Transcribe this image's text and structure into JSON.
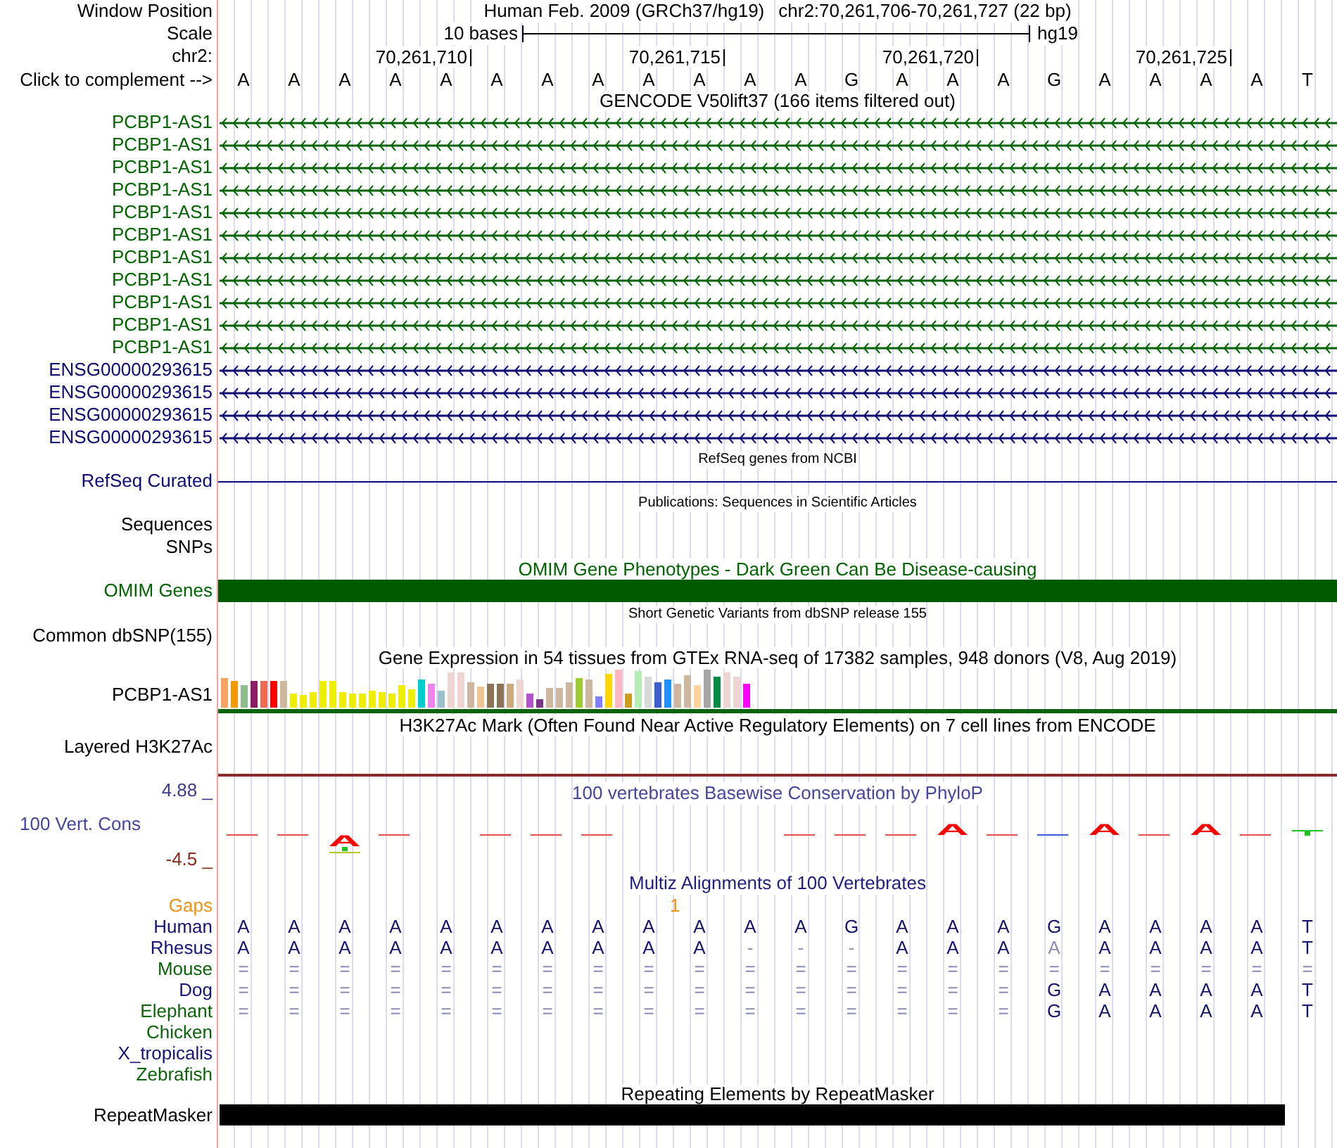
{
  "position": {
    "label": "Window Position",
    "assembly": "Human Feb. 2009 (GRCh37/hg19)",
    "region": "chr2:70,261,706-70,261,727 (22 bp)"
  },
  "scale": {
    "label": "Scale",
    "length": "10 bases",
    "assembly": "hg19"
  },
  "coordinates": {
    "label": "chr2:",
    "ticks": [
      "70,261,710",
      "70,261,715",
      "70,261,720",
      "70,261,725"
    ]
  },
  "sequence": {
    "label": "Click to complement -->",
    "bases": [
      "A",
      "A",
      "A",
      "A",
      "A",
      "A",
      "A",
      "A",
      "A",
      "A",
      "A",
      "A",
      "G",
      "A",
      "A",
      "A",
      "G",
      "A",
      "A",
      "A",
      "A",
      "T"
    ]
  },
  "gencode": {
    "title": "GENCODE V50lift37 (166 items filtered out)",
    "items": [
      {
        "name": "PCBP1-AS1",
        "color": "#006400"
      },
      {
        "name": "PCBP1-AS1",
        "color": "#006400"
      },
      {
        "name": "PCBP1-AS1",
        "color": "#006400"
      },
      {
        "name": "PCBP1-AS1",
        "color": "#006400"
      },
      {
        "name": "PCBP1-AS1",
        "color": "#006400"
      },
      {
        "name": "PCBP1-AS1",
        "color": "#006400"
      },
      {
        "name": "PCBP1-AS1",
        "color": "#006400"
      },
      {
        "name": "PCBP1-AS1",
        "color": "#006400"
      },
      {
        "name": "PCBP1-AS1",
        "color": "#006400"
      },
      {
        "name": "PCBP1-AS1",
        "color": "#006400"
      },
      {
        "name": "PCBP1-AS1",
        "color": "#006400"
      },
      {
        "name": "ENSG00000293615",
        "color": "#0c0c78"
      },
      {
        "name": "ENSG00000293615",
        "color": "#0c0c78"
      },
      {
        "name": "ENSG00000293615",
        "color": "#0c0c78"
      },
      {
        "name": "ENSG00000293615",
        "color": "#0c0c78"
      }
    ]
  },
  "refseq": {
    "title": "RefSeq genes from NCBI",
    "items": [
      {
        "name": "RefSeq Curated",
        "color": "#0c0c78"
      }
    ]
  },
  "publications": {
    "title": "Publications: Sequences in Scientific Articles",
    "rows": [
      "Sequences",
      "SNPs"
    ]
  },
  "omim": {
    "title": "OMIM Gene Phenotypes - Dark Green Can Be Disease-causing",
    "label": "OMIM Genes"
  },
  "dbsnp": {
    "title": "Short Genetic Variants from dbSNP release 155",
    "label": "Common dbSNP(155)"
  },
  "gtex": {
    "title": "Gene Expression in 54 tissues from GTEx RNA-seq of 17382 samples, 948 donors (V8, Aug 2019)",
    "label": "PCBP1-AS1"
  },
  "h3k27ac": {
    "title": "H3K27Ac Mark (Often Found Near Active Regulatory Elements) on 7 cell lines from ENCODE",
    "label": "Layered H3K27Ac"
  },
  "phylop": {
    "title": "100 vertebrates Basewise Conservation by PhyloP",
    "label": "100 Vert. Cons",
    "max": "4.88 _",
    "min": "-4.5 _",
    "marks": [
      {
        "kind": "dash",
        "color": "#e85050"
      },
      {
        "kind": "dash",
        "color": "#e85050"
      },
      {
        "kind": "letter_low",
        "text": "A",
        "color": "#ff0000"
      },
      {
        "kind": "dash",
        "color": "#e85050"
      },
      {
        "kind": "none"
      },
      {
        "kind": "dash",
        "color": "#e85050"
      },
      {
        "kind": "dash",
        "color": "#e85050"
      },
      {
        "kind": "dash",
        "color": "#e85050"
      },
      {
        "kind": "none"
      },
      {
        "kind": "none"
      },
      {
        "kind": "none"
      },
      {
        "kind": "dash",
        "color": "#e85050"
      },
      {
        "kind": "dash",
        "color": "#e85050"
      },
      {
        "kind": "dash",
        "color": "#e85050"
      },
      {
        "kind": "letter",
        "text": "A",
        "color": "#ff0000"
      },
      {
        "kind": "dash",
        "color": "#e85050"
      },
      {
        "kind": "dash",
        "color": "#3c5adc"
      },
      {
        "kind": "letter",
        "text": "A",
        "color": "#ff0000"
      },
      {
        "kind": "dash",
        "color": "#e85050"
      },
      {
        "kind": "letter",
        "text": "A",
        "color": "#ff0000"
      },
      {
        "kind": "dash",
        "color": "#e85050"
      },
      {
        "kind": "square",
        "color": "#22c422"
      }
    ]
  },
  "multiz": {
    "title": "Multiz Alignments of 100 Vertebrates",
    "gaps": {
      "label": "Gaps",
      "count": "1"
    },
    "species": [
      {
        "name": "Human",
        "color": "#14147a",
        "bases": [
          {
            "base": "A",
            "faded": false
          },
          {
            "base": "A",
            "faded": false
          },
          {
            "base": "A",
            "faded": false
          },
          {
            "base": "A",
            "faded": false
          },
          {
            "base": "A",
            "faded": false
          },
          {
            "base": "A",
            "faded": false
          },
          {
            "base": "A",
            "faded": false
          },
          {
            "base": "A",
            "faded": false
          },
          {
            "base": "A",
            "faded": false
          },
          {
            "base": "A",
            "faded": false
          },
          {
            "base": "A",
            "faded": false
          },
          {
            "base": "A",
            "faded": false
          },
          {
            "base": "G",
            "faded": false
          },
          {
            "base": "A",
            "faded": false
          },
          {
            "base": "A",
            "faded": false
          },
          {
            "base": "A",
            "faded": false
          },
          {
            "base": "G",
            "faded": false
          },
          {
            "base": "A",
            "faded": false
          },
          {
            "base": "A",
            "faded": false
          },
          {
            "base": "A",
            "faded": false
          },
          {
            "base": "A",
            "faded": false
          },
          {
            "base": "T",
            "faded": false
          }
        ]
      },
      {
        "name": "Rhesus",
        "color": "#14147a",
        "bases": [
          {
            "base": "A",
            "faded": false
          },
          {
            "base": "A",
            "faded": false
          },
          {
            "base": "A",
            "faded": false
          },
          {
            "base": "A",
            "faded": false
          },
          {
            "base": "A",
            "faded": false
          },
          {
            "base": "A",
            "faded": false
          },
          {
            "base": "A",
            "faded": false
          },
          {
            "base": "A",
            "faded": false
          },
          {
            "base": "A",
            "faded": false
          },
          {
            "base": "A",
            "faded": false
          },
          {
            "base": "-",
            "faded": true
          },
          {
            "base": "-",
            "faded": true
          },
          {
            "base": "-",
            "faded": true
          },
          {
            "base": "A",
            "faded": false
          },
          {
            "base": "A",
            "faded": false
          },
          {
            "base": "A",
            "faded": false
          },
          {
            "base": "A",
            "faded": true
          },
          {
            "base": "A",
            "faded": false
          },
          {
            "base": "A",
            "faded": false
          },
          {
            "base": "A",
            "faded": false
          },
          {
            "base": "A",
            "faded": false
          },
          {
            "base": "T",
            "faded": false
          }
        ]
      },
      {
        "name": "Mouse",
        "color": "#0a640a",
        "bases": [
          {
            "base": "=",
            "faded": true
          },
          {
            "base": "=",
            "faded": true
          },
          {
            "base": "=",
            "faded": true
          },
          {
            "base": "=",
            "faded": true
          },
          {
            "base": "=",
            "faded": true
          },
          {
            "base": "=",
            "faded": true
          },
          {
            "base": "=",
            "faded": true
          },
          {
            "base": "=",
            "faded": true
          },
          {
            "base": "=",
            "faded": true
          },
          {
            "base": "=",
            "faded": true
          },
          {
            "base": "=",
            "faded": true
          },
          {
            "base": "=",
            "faded": true
          },
          {
            "base": "=",
            "faded": true
          },
          {
            "base": "=",
            "faded": true
          },
          {
            "base": "=",
            "faded": true
          },
          {
            "base": "=",
            "faded": true
          },
          {
            "base": "=",
            "faded": true
          },
          {
            "base": "=",
            "faded": true
          },
          {
            "base": "=",
            "faded": true
          },
          {
            "base": "=",
            "faded": true
          },
          {
            "base": "=",
            "faded": true
          },
          {
            "base": "=",
            "faded": true
          }
        ]
      },
      {
        "name": "Dog",
        "color": "#14147a",
        "bases": [
          {
            "base": "=",
            "faded": true
          },
          {
            "base": "=",
            "faded": true
          },
          {
            "base": "=",
            "faded": true
          },
          {
            "base": "=",
            "faded": true
          },
          {
            "base": "=",
            "faded": true
          },
          {
            "base": "=",
            "faded": true
          },
          {
            "base": "=",
            "faded": true
          },
          {
            "base": "=",
            "faded": true
          },
          {
            "base": "=",
            "faded": true
          },
          {
            "base": "=",
            "faded": true
          },
          {
            "base": "=",
            "faded": true
          },
          {
            "base": "=",
            "faded": true
          },
          {
            "base": "=",
            "faded": true
          },
          {
            "base": "=",
            "faded": true
          },
          {
            "base": "=",
            "faded": true
          },
          {
            "base": "=",
            "faded": true
          },
          {
            "base": "G",
            "faded": false
          },
          {
            "base": "A",
            "faded": false
          },
          {
            "base": "A",
            "faded": false
          },
          {
            "base": "A",
            "faded": false
          },
          {
            "base": "A",
            "faded": false
          },
          {
            "base": "T",
            "faded": false
          }
        ]
      },
      {
        "name": "Elephant",
        "color": "#0a640a",
        "bases": [
          {
            "base": "=",
            "faded": true
          },
          {
            "base": "=",
            "faded": true
          },
          {
            "base": "=",
            "faded": true
          },
          {
            "base": "=",
            "faded": true
          },
          {
            "base": "=",
            "faded": true
          },
          {
            "base": "=",
            "faded": true
          },
          {
            "base": "=",
            "faded": true
          },
          {
            "base": "=",
            "faded": true
          },
          {
            "base": "=",
            "faded": true
          },
          {
            "base": "=",
            "faded": true
          },
          {
            "base": "=",
            "faded": true
          },
          {
            "base": "=",
            "faded": true
          },
          {
            "base": "=",
            "faded": true
          },
          {
            "base": "=",
            "faded": true
          },
          {
            "base": "=",
            "faded": true
          },
          {
            "base": "=",
            "faded": true
          },
          {
            "base": "G",
            "faded": false
          },
          {
            "base": "A",
            "faded": false
          },
          {
            "base": "A",
            "faded": false
          },
          {
            "base": "A",
            "faded": false
          },
          {
            "base": "A",
            "faded": false
          },
          {
            "base": "T",
            "faded": false
          }
        ]
      },
      {
        "name": "Chicken",
        "color": "#0a640a"
      },
      {
        "name": "X_tropicalis",
        "color": "#14147a"
      },
      {
        "name": "Zebrafish",
        "color": "#0a640a"
      }
    ]
  },
  "repeatmasker": {
    "title": "Repeating Elements by RepeatMasker",
    "label": "RepeatMasker"
  }
}
